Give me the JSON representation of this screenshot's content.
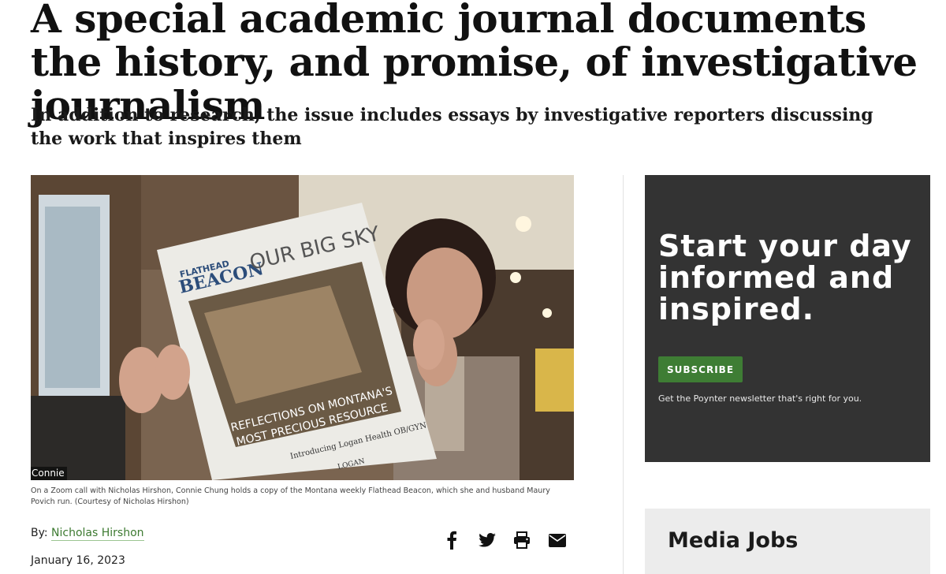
{
  "article": {
    "headline": "A special academic journal documents the history, and promise, of investigative journalism",
    "dek": "In addition to research, the issue includes essays by investigative reporters discussing the work that inspires them",
    "photo": {
      "zoom_label": "Connie",
      "masthead_top": "FLATHEAD",
      "masthead_bottom": "BEACON",
      "cover_title": "OUR BIG SKY",
      "cover_headline_1": "REFLECTIONS ON MONTANA'S",
      "cover_headline_2": "MOST PRECIOUS RESOURCE",
      "cover_sub": "Introducing Logan Health OB/GYN",
      "cover_logo": "LOGAN"
    },
    "caption": "On a Zoom call with Nicholas Hirshon, Connie Chung holds a copy of the Montana weekly Flathead Beacon, which she and husband Maury Povich run. (Courtesy of Nicholas Hirshon)",
    "byline_prefix": "By:",
    "author": "Nicholas Hirshon",
    "date": "January 16, 2023",
    "share_icons": [
      "facebook-icon",
      "twitter-icon",
      "print-icon",
      "email-icon"
    ]
  },
  "promo": {
    "heading": "Start your day informed and inspired.",
    "button_label": "SUBSCRIBE",
    "note": "Get the Poynter newsletter that's right for you."
  },
  "jobs": {
    "heading": "Media Jobs"
  },
  "colors": {
    "accent_green": "#3e7d34",
    "promo_bg": "#333333",
    "jobs_bg": "#ececec"
  }
}
